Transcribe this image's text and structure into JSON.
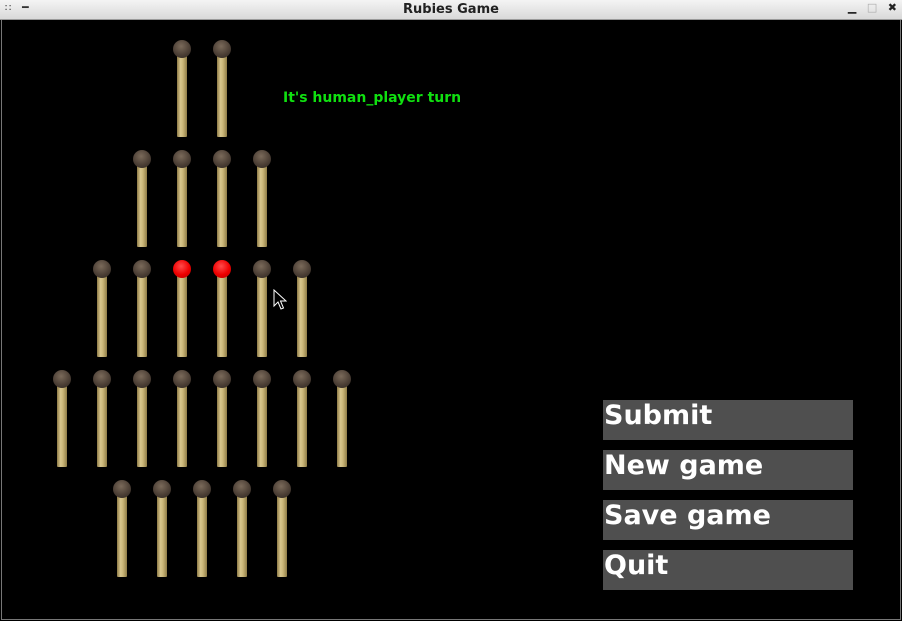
{
  "window": {
    "title": "Rubies Game",
    "menu_icon": "grip-icon",
    "controls": [
      "minimize-icon",
      "maximize-icon",
      "close-icon"
    ]
  },
  "status_text": "It's human_player turn",
  "board": {
    "rows": [
      {
        "count": 2,
        "selected": []
      },
      {
        "count": 4,
        "selected": []
      },
      {
        "count": 6,
        "selected": [
          2,
          3
        ]
      },
      {
        "count": 8,
        "selected": []
      },
      {
        "count": 5,
        "selected": []
      }
    ],
    "colors": {
      "match_head": "#4d4036",
      "selected_head": "#ee0000",
      "stick": "#c9b577",
      "status": "#10e010",
      "button_bg": "#4f4f4f"
    }
  },
  "buttons": {
    "submit": "Submit",
    "new_game": "New game",
    "save_game": "Save game",
    "quit": "Quit"
  }
}
